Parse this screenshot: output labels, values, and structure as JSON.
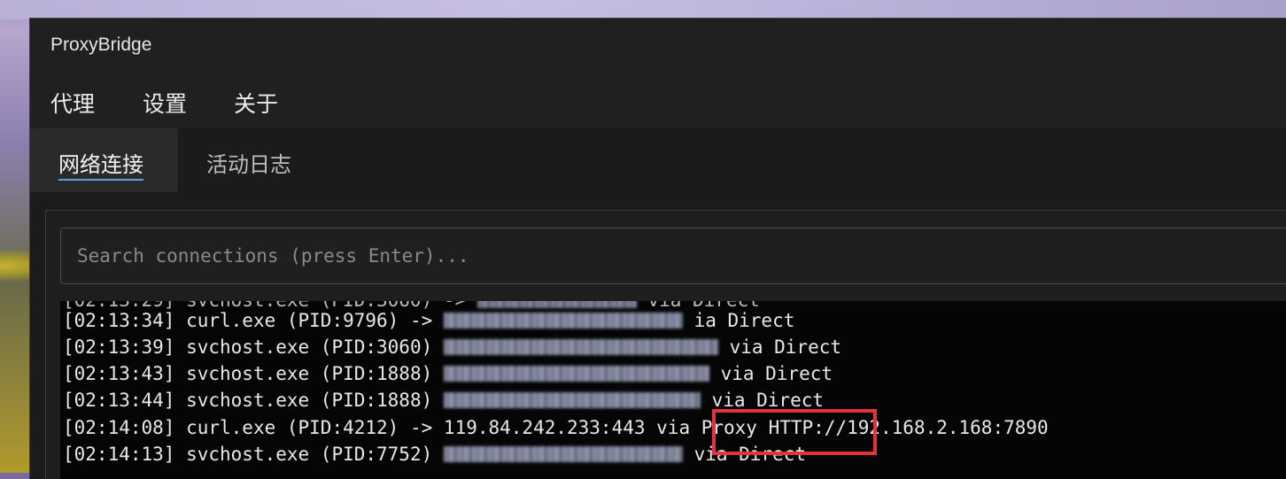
{
  "window": {
    "title": "ProxyBridge"
  },
  "menu": {
    "items": [
      "代理",
      "设置",
      "关于"
    ]
  },
  "tabs": [
    {
      "label": "网络连接",
      "active": true
    },
    {
      "label": "活动日志",
      "active": false
    }
  ],
  "search": {
    "placeholder": "Search connections (press Enter)...",
    "value": ""
  },
  "log": [
    {
      "time": "[02:13:34]",
      "process": "curl.exe (PID:9796)",
      "arrow": "->",
      "target_visible": false,
      "route": "ia Direct"
    },
    {
      "time": "[02:13:39]",
      "process": "svchost.exe (PID:3060)",
      "arrow": "->",
      "target_visible": false,
      "route": "via Direct"
    },
    {
      "time": "[02:13:43]",
      "process": "svchost.exe (PID:1888)",
      "arrow": "->",
      "target_visible": false,
      "route": "via Direct"
    },
    {
      "time": "[02:13:44]",
      "process": "svchost.exe (PID:1888)",
      "arrow": "->",
      "target_visible": false,
      "route": "via Direct"
    },
    {
      "time": "[02:14:08]",
      "process": "curl.exe (PID:4212)",
      "arrow": "->",
      "target": "119.84.242.233:443",
      "target_visible": true,
      "route": "via Proxy HTTP://192.168.2.168:7890"
    },
    {
      "time": "[02:14:13]",
      "process": "svchost.exe (PID:7752)",
      "arrow": "->",
      "target_visible": false,
      "route": "via Direct"
    }
  ],
  "colors": {
    "window_bg": "#1f1f1f",
    "log_bg": "#050505",
    "text": "#e8e8e8",
    "tab_underline": "#5aa0e6",
    "highlight": "#e4313c"
  }
}
